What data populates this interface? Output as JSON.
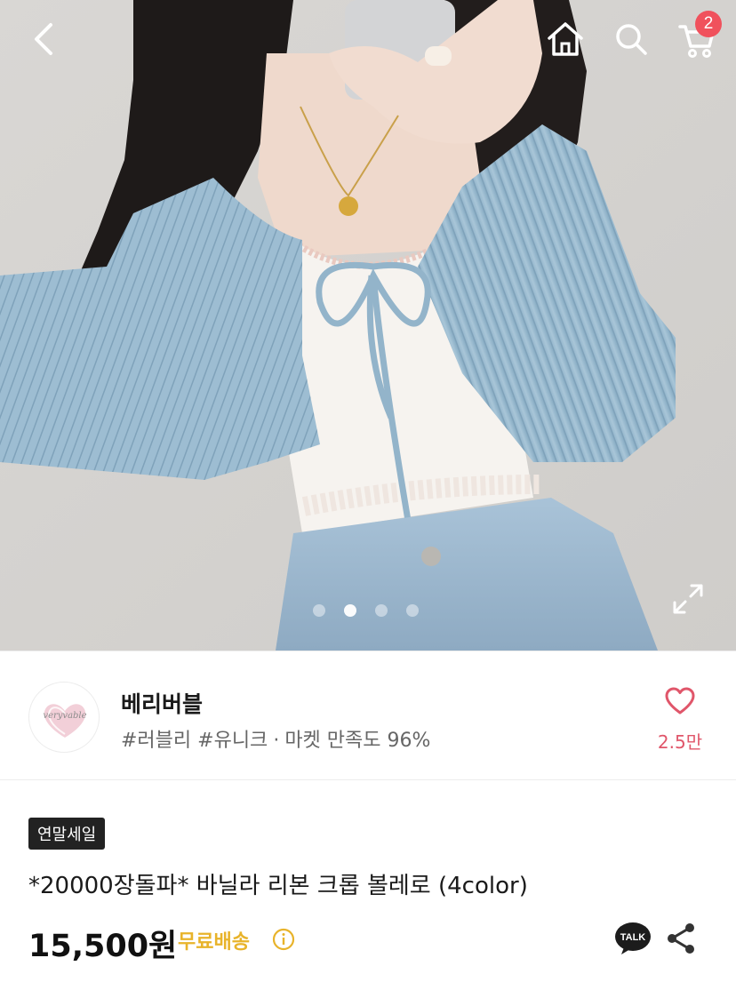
{
  "header": {
    "back_icon": "chevron-left-icon",
    "home_icon": "home-icon",
    "search_icon": "search-icon",
    "cart_icon": "cart-icon",
    "cart_count": "2"
  },
  "gallery": {
    "image_count": 4,
    "active_index": 1,
    "expand_icon": "expand-icon"
  },
  "seller": {
    "logo_text": "veryvable",
    "name": "베리버블",
    "tags": "#러블리 #유니크",
    "separator": "·",
    "satisfaction": "마켓 만족도 96%",
    "like_count": "2.5만"
  },
  "product": {
    "badge": "연말세일",
    "title": "*20000장돌파* 바닐라 리본 크롭 볼레로 (4color)",
    "price": "15,500원",
    "shipping": "무료배송",
    "talk_label": "TALK"
  },
  "colors": {
    "badge_red": "#f0515c",
    "heart_pink": "#e0566a",
    "shipping_yellow": "#e8b32a"
  }
}
